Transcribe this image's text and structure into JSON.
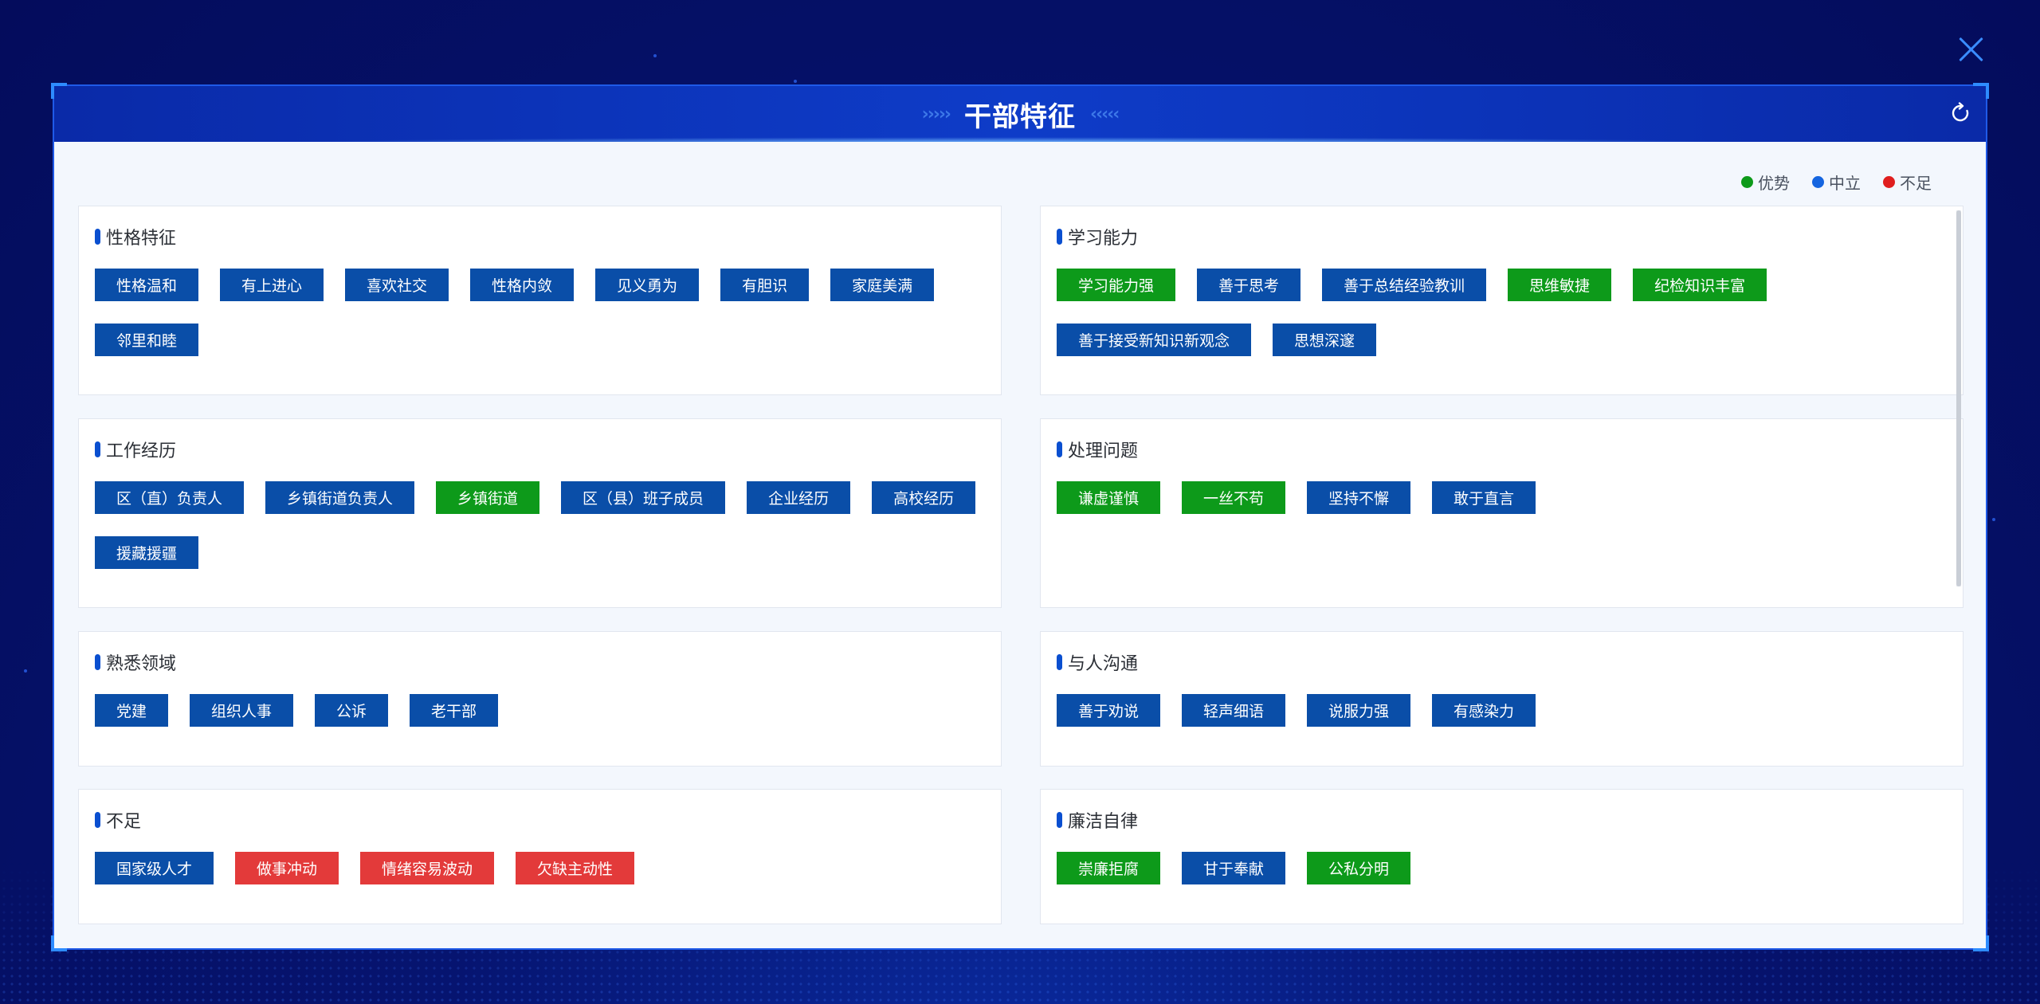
{
  "modal": {
    "title": "干部特征"
  },
  "legend": [
    {
      "label": "优势",
      "color": "#0d9a1a"
    },
    {
      "label": "中立",
      "color": "#1565e0"
    },
    {
      "label": "不足",
      "color": "#e01e1e"
    }
  ],
  "colors": {
    "advantage": "#0d9a1a",
    "neutral": "#0a4ea8",
    "shortcoming": "#e33a3a"
  },
  "sections": [
    {
      "title": "性格特征",
      "tags": [
        {
          "label": "性格温和",
          "type": "blue"
        },
        {
          "label": "有上进心",
          "type": "blue"
        },
        {
          "label": "喜欢社交",
          "type": "blue"
        },
        {
          "label": "性格内敛",
          "type": "blue"
        },
        {
          "label": "见义勇为",
          "type": "blue"
        },
        {
          "label": "有胆识",
          "type": "blue"
        },
        {
          "label": "家庭美满",
          "type": "blue"
        },
        {
          "label": "邻里和睦",
          "type": "blue"
        }
      ]
    },
    {
      "title": "学习能力",
      "tags": [
        {
          "label": "学习能力强",
          "type": "green"
        },
        {
          "label": "善于思考",
          "type": "blue"
        },
        {
          "label": "善于总结经验教训",
          "type": "blue"
        },
        {
          "label": "思维敏捷",
          "type": "green"
        },
        {
          "label": "纪检知识丰富",
          "type": "green"
        },
        {
          "label": "善于接受新知识新观念",
          "type": "blue"
        },
        {
          "label": "思想深邃",
          "type": "blue"
        }
      ]
    },
    {
      "title": "工作经历",
      "tags": [
        {
          "label": "区（直）负责人",
          "type": "blue"
        },
        {
          "label": "乡镇街道负责人",
          "type": "blue"
        },
        {
          "label": "乡镇街道",
          "type": "green"
        },
        {
          "label": "区（县）班子成员",
          "type": "blue"
        },
        {
          "label": "企业经历",
          "type": "blue"
        },
        {
          "label": "高校经历",
          "type": "blue"
        },
        {
          "label": "援藏援疆",
          "type": "blue"
        }
      ]
    },
    {
      "title": "处理问题",
      "tags": [
        {
          "label": "谦虚谨慎",
          "type": "green"
        },
        {
          "label": "一丝不苟",
          "type": "green"
        },
        {
          "label": "坚持不懈",
          "type": "blue"
        },
        {
          "label": "敢于直言",
          "type": "blue"
        }
      ]
    },
    {
      "title": "熟悉领域",
      "tags": [
        {
          "label": "党建",
          "type": "blue"
        },
        {
          "label": "组织人事",
          "type": "blue"
        },
        {
          "label": "公诉",
          "type": "blue"
        },
        {
          "label": "老干部",
          "type": "blue"
        }
      ]
    },
    {
      "title": "与人沟通",
      "tags": [
        {
          "label": "善于劝说",
          "type": "blue"
        },
        {
          "label": "轻声细语",
          "type": "blue"
        },
        {
          "label": "说服力强",
          "type": "blue"
        },
        {
          "label": "有感染力",
          "type": "blue"
        }
      ]
    },
    {
      "title": "不足",
      "tags": [
        {
          "label": "国家级人才",
          "type": "blue"
        },
        {
          "label": "做事冲动",
          "type": "red"
        },
        {
          "label": "情绪容易波动",
          "type": "red"
        },
        {
          "label": "欠缺主动性",
          "type": "red"
        }
      ]
    },
    {
      "title": "廉洁自律",
      "tags": [
        {
          "label": "崇廉拒腐",
          "type": "green"
        },
        {
          "label": "甘于奉献",
          "type": "blue"
        },
        {
          "label": "公私分明",
          "type": "green"
        }
      ]
    }
  ]
}
